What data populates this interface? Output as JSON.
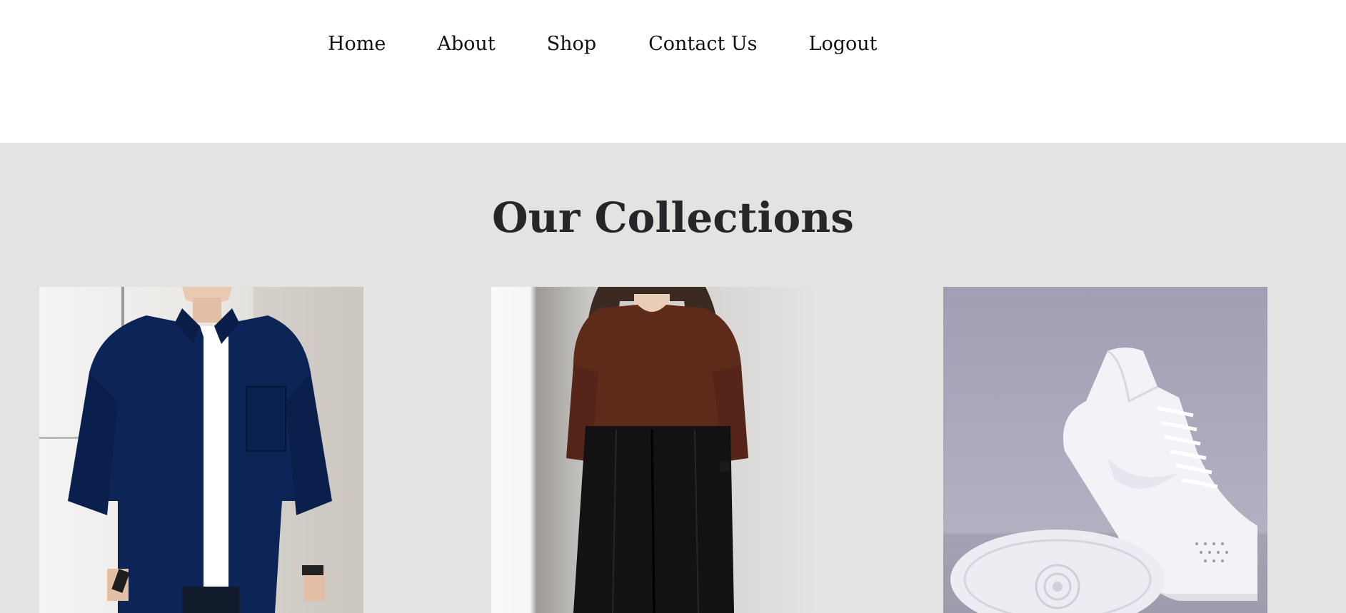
{
  "nav": {
    "items": [
      {
        "label": "Home"
      },
      {
        "label": "About"
      },
      {
        "label": "Shop"
      },
      {
        "label": "Contact Us"
      },
      {
        "label": "Logout"
      }
    ]
  },
  "collections": {
    "title": "Our Collections",
    "products": [
      {
        "image": "man-navy-shirt-photo"
      },
      {
        "image": "woman-brown-top-black-trousers-photo"
      },
      {
        "image": "white-sneakers-photo"
      }
    ]
  },
  "colors": {
    "header_bg": "#ffffff",
    "section_bg": "#e4e3e1",
    "title_color": "#26262a",
    "nav_text": "#111111"
  }
}
